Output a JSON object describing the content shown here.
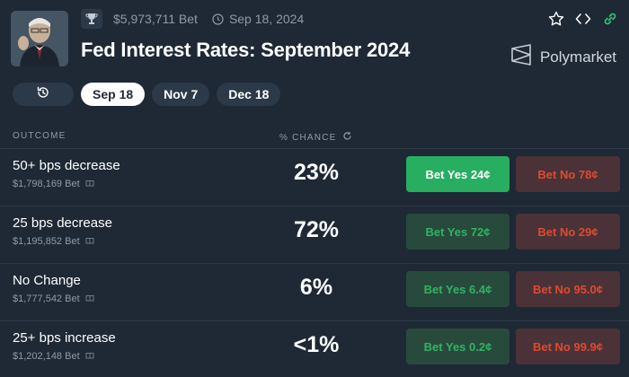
{
  "header": {
    "total_bet": "$5,973,711 Bet",
    "date": "Sep 18, 2024",
    "title": "Fed Interest Rates: September 2024",
    "brand": "Polymarket"
  },
  "tabs": [
    {
      "label": "Sep 18",
      "active": true
    },
    {
      "label": "Nov 7",
      "active": false
    },
    {
      "label": "Dec 18",
      "active": false
    }
  ],
  "columns": {
    "outcome": "OUTCOME",
    "chance": "% CHANCE"
  },
  "outcomes": [
    {
      "name": "50+ bps decrease",
      "bet": "$1,798,169 Bet",
      "chance": "23%",
      "yes": "Bet Yes 24¢",
      "no": "Bet No 78¢"
    },
    {
      "name": "25 bps decrease",
      "bet": "$1,195,852 Bet",
      "chance": "72%",
      "yes": "Bet Yes 72¢",
      "no": "Bet No 29¢"
    },
    {
      "name": "No Change",
      "bet": "$1,777,542 Bet",
      "chance": "6%",
      "yes": "Bet Yes 6.4¢",
      "no": "Bet No 95.0¢"
    },
    {
      "name": "25+ bps increase",
      "bet": "$1,202,148 Bet",
      "chance": "<1%",
      "yes": "Bet Yes 0.2¢",
      "no": "Bet No 99.9¢"
    }
  ],
  "colors": {
    "background": "#1e2935",
    "yes_active": "#27ae60",
    "yes": "#31b362",
    "no": "#e04a2f",
    "link_green": "#2ecc71"
  },
  "icons": [
    "trophy-icon",
    "clock-icon",
    "star-icon",
    "embed-icon",
    "link-icon",
    "polymarket-logo-icon",
    "history-icon",
    "refresh-icon",
    "gift-icon"
  ]
}
